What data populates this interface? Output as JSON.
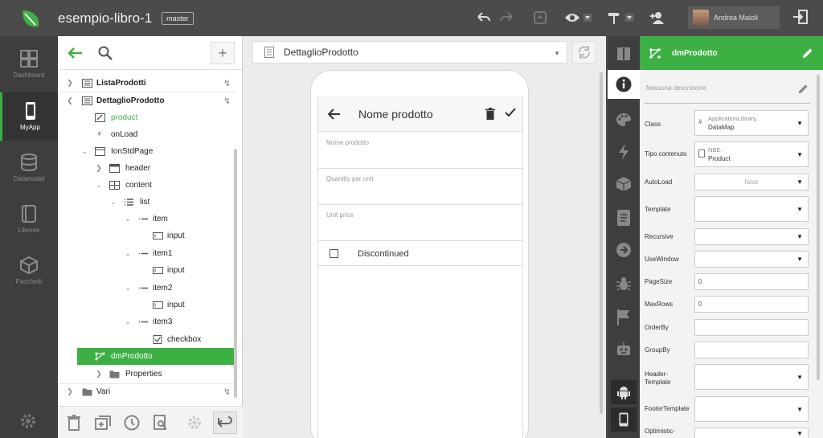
{
  "app": {
    "title": "esempio-libro-1",
    "branch": "master",
    "user": "Andrea Maioli",
    "colors": {
      "accent": "#3cb043",
      "dark": "#4b4b4b"
    }
  },
  "rail": {
    "items": [
      {
        "label": "Dashboard",
        "icon": "dashboard-icon"
      },
      {
        "label": "MyApp",
        "icon": "phone-icon"
      },
      {
        "label": "Datamodel",
        "icon": "database-icon"
      },
      {
        "label": "Librerie",
        "icon": "book-icon"
      },
      {
        "label": "Pacchetti",
        "icon": "package-icon"
      }
    ]
  },
  "tree": {
    "rows": [
      {
        "label": "ListaProdotti"
      },
      {
        "label": "DettaglioProdotto"
      },
      {
        "label": "product"
      },
      {
        "label": "onLoad"
      },
      {
        "label": "IonStdPage"
      },
      {
        "label": "header"
      },
      {
        "label": "content"
      },
      {
        "label": "list"
      },
      {
        "label": "item"
      },
      {
        "label": "input"
      },
      {
        "label": "item1"
      },
      {
        "label": "input"
      },
      {
        "label": "item2"
      },
      {
        "label": "input"
      },
      {
        "label": "item3"
      },
      {
        "label": "checkbox"
      },
      {
        "label": "dmProdotto"
      },
      {
        "label": "Properties"
      },
      {
        "label": "Vari"
      }
    ]
  },
  "center": {
    "page_selected": "DettaglioProdotto",
    "preview": {
      "title": "Nome prodotto",
      "fields": [
        {
          "placeholder": "Nome prodotto"
        },
        {
          "placeholder": "Quantity per unit"
        },
        {
          "placeholder": "Unit price"
        }
      ],
      "checkbox_label": "Discontinued"
    }
  },
  "props": {
    "title": "dmProdotto",
    "description": "Nessuna descrizione",
    "rows": [
      {
        "label": "Class",
        "v1": "ApplicationLibrary.",
        "v2": "DataMap"
      },
      {
        "label": "Tipo contenuto",
        "v1": "NBE.",
        "v2": "Product"
      },
      {
        "label": "AutoLoad",
        "value": "false"
      },
      {
        "label": "Template",
        "value": ""
      },
      {
        "label": "Recursive",
        "value": ""
      },
      {
        "label": "UseWindow",
        "value": ""
      },
      {
        "label": "PageSize",
        "value": "0"
      },
      {
        "label": "MaxRows",
        "value": "0"
      },
      {
        "label": "OrderBy",
        "value": ""
      },
      {
        "label": "GroupBy",
        "value": ""
      },
      {
        "label": "Header-\nTemplate",
        "value": ""
      },
      {
        "label": "FooterTemplate",
        "value": ""
      },
      {
        "label": "Optimistic-",
        "value": ""
      }
    ]
  }
}
